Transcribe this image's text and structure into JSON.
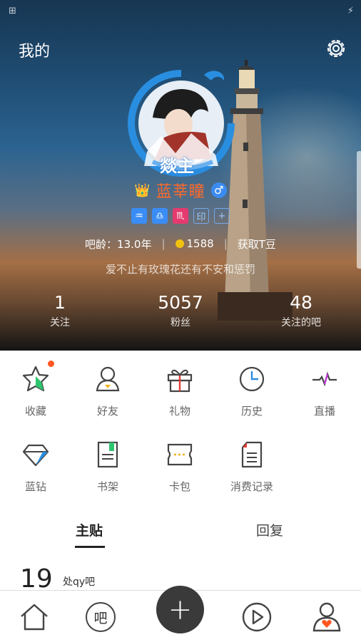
{
  "status": {
    "left": "⊞",
    "right": "⚡"
  },
  "header": {
    "title": "我的"
  },
  "profile": {
    "avatar_tag": "燚主",
    "name": "蓝莘瞳",
    "gender_icon": "♂",
    "badges": [
      "♒",
      "♎",
      "♏",
      "印",
      "+"
    ],
    "age_label": "吧龄：13.0年",
    "coins": "1588",
    "coins_action": "获取T豆",
    "bio": "爱不止有玫瑰花还有不安和惩罚"
  },
  "stats": [
    {
      "num": "1",
      "label": "关注"
    },
    {
      "num": "5057",
      "label": "粉丝"
    },
    {
      "num": "48",
      "label": "关注的吧"
    }
  ],
  "menu": [
    {
      "label": "收藏",
      "icon": "star-icon",
      "has_dot": true
    },
    {
      "label": "好友",
      "icon": "friend-icon"
    },
    {
      "label": "礼物",
      "icon": "gift-icon"
    },
    {
      "label": "历史",
      "icon": "clock-icon"
    },
    {
      "label": "直播",
      "icon": "live-icon"
    },
    {
      "label": "蓝钻",
      "icon": "diamond-icon"
    },
    {
      "label": "书架",
      "icon": "bookshelf-icon"
    },
    {
      "label": "卡包",
      "icon": "card-pack-icon"
    },
    {
      "label": "消费记录",
      "icon": "receipt-icon"
    }
  ],
  "tabs": {
    "posts": "主贴",
    "replies": "回复"
  },
  "post_preview": {
    "date": "19",
    "bar": "处qy吧"
  },
  "bottom_nav": {
    "center": "+",
    "bar_icon_text": "吧"
  },
  "colors": {
    "accent": "#3a8df5",
    "name": "#ff6a2b",
    "dot": "#ff5722",
    "fab": "#3a3a3a"
  }
}
